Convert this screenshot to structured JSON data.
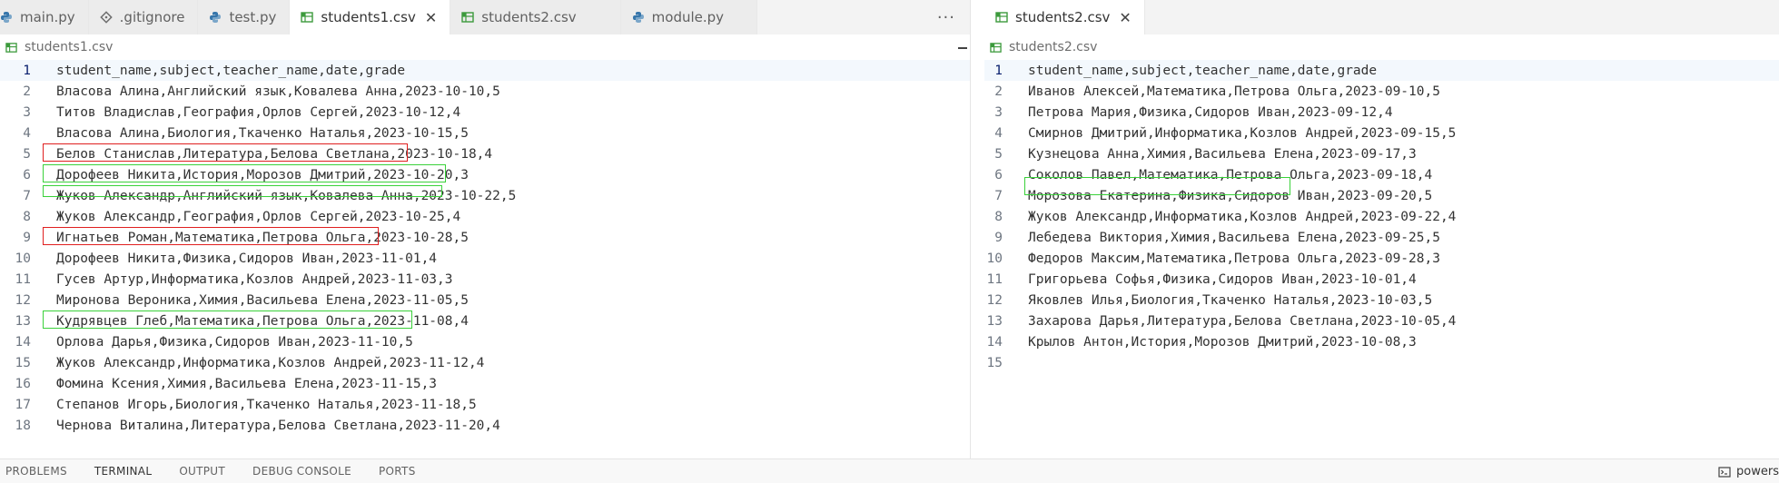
{
  "left_group": {
    "tabs": [
      {
        "label": "main.py",
        "icon": "python-icon"
      },
      {
        "label": ".gitignore",
        "icon": "git-icon"
      },
      {
        "label": "test.py",
        "icon": "python-icon"
      },
      {
        "label": "students1.csv",
        "icon": "csv-table-icon",
        "active": true
      },
      {
        "label": "students2.csv",
        "icon": "csv-table-icon"
      },
      {
        "label": "module.py",
        "icon": "python-icon"
      }
    ],
    "more_label": "···",
    "breadcrumb": "students1.csv",
    "lines": [
      {
        "n": "1",
        "text": "student_name,subject,teacher_name,date,grade"
      },
      {
        "n": "2",
        "text": "Власова Алина,Английский язык,Ковалева Анна,2023-10-10,5"
      },
      {
        "n": "3",
        "text": "Титов Владислав,География,Орлов Сергей,2023-10-12,4"
      },
      {
        "n": "4",
        "text": "Власова Алина,Биология,Ткаченко Наталья,2023-10-15,5"
      },
      {
        "n": "5",
        "text": "Белов Станислав,Литература,Белова Светлана,2023-10-18,4"
      },
      {
        "n": "6",
        "text": "Дорофеев Никита,История,Морозов Дмитрий,2023-10-20,3"
      },
      {
        "n": "7",
        "text": "Жуков Александр,Английский язык,Ковалева Анна,2023-10-22,5"
      },
      {
        "n": "8",
        "text": "Жуков Александр,География,Орлов Сергей,2023-10-25,4"
      },
      {
        "n": "9",
        "text": "Игнатьев Роман,Математика,Петрова Ольга,2023-10-28,5"
      },
      {
        "n": "10",
        "text": "Дорофеев Никита,Физика,Сидоров Иван,2023-11-01,4"
      },
      {
        "n": "11",
        "text": "Гусев Артур,Информатика,Козлов Андрей,2023-11-03,3"
      },
      {
        "n": "12",
        "text": "Миронова Вероника,Химия,Васильева Елена,2023-11-05,5"
      },
      {
        "n": "13",
        "text": "Кудрявцев Глеб,Математика,Петрова Ольга,2023-11-08,4"
      },
      {
        "n": "14",
        "text": "Орлова Дарья,Физика,Сидоров Иван,2023-11-10,5"
      },
      {
        "n": "15",
        "text": "Жуков Александр,Информатика,Козлов Андрей,2023-11-12,4"
      },
      {
        "n": "16",
        "text": "Фомина Ксения,Химия,Васильева Елена,2023-11-15,3"
      },
      {
        "n": "17",
        "text": "Степанов Игорь,Биология,Ткаченко Наталья,2023-11-18,5"
      },
      {
        "n": "18",
        "text": "Чернова Виталина,Литература,Белова Светлана,2023-11-20,4"
      }
    ]
  },
  "right_group": {
    "tabs": [
      {
        "label": "students2.csv",
        "icon": "csv-table-icon",
        "active": true
      }
    ],
    "close_glyph": "✕",
    "breadcrumb": "students2.csv",
    "lines": [
      {
        "n": "1",
        "text": "student_name,subject,teacher_name,date,grade"
      },
      {
        "n": "2",
        "text": "Иванов Алексей,Математика,Петрова Ольга,2023-09-10,5"
      },
      {
        "n": "3",
        "text": "Петрова Мария,Физика,Сидоров Иван,2023-09-12,4"
      },
      {
        "n": "4",
        "text": "Смирнов Дмитрий,Информатика,Козлов Андрей,2023-09-15,5"
      },
      {
        "n": "5",
        "text": "Кузнецова Анна,Химия,Васильева Елена,2023-09-17,3"
      },
      {
        "n": "6",
        "text": "Соколов Павел,Математика,Петрова Ольга,2023-09-18,4"
      },
      {
        "n": "7",
        "text": "Морозова Екатерина,Физика,Сидоров Иван,2023-09-20,5"
      },
      {
        "n": "8",
        "text": "Жуков Александр,Информатика,Козлов Андрей,2023-09-22,4"
      },
      {
        "n": "9",
        "text": "Лебедева Виктория,Химия,Васильева Елена,2023-09-25,5"
      },
      {
        "n": "10",
        "text": "Федоров Максим,Математика,Петрова Ольга,2023-09-28,3"
      },
      {
        "n": "11",
        "text": "Григорьева Софья,Физика,Сидоров Иван,2023-10-01,4"
      },
      {
        "n": "12",
        "text": "Яковлев Илья,Биология,Ткаченко Наталья,2023-10-03,5"
      },
      {
        "n": "13",
        "text": "Захарова Дарья,Литература,Белова Светлана,2023-10-05,4"
      },
      {
        "n": "14",
        "text": "Крылов Антон,История,Морозов Дмитрий,2023-10-08,3"
      },
      {
        "n": "15",
        "text": ""
      }
    ]
  },
  "panel": {
    "tabs": [
      "PROBLEMS",
      "TERMINAL",
      "OUTPUT",
      "DEBUG CONSOLE",
      "PORTS"
    ],
    "active_tab": "TERMINAL",
    "terminal_label": "powers"
  },
  "colors": {
    "highlight_red": "#e01f1f",
    "highlight_green": "#3ad13a",
    "csv_icon": "#3c9a3c",
    "python_icon": "#3776ab"
  }
}
